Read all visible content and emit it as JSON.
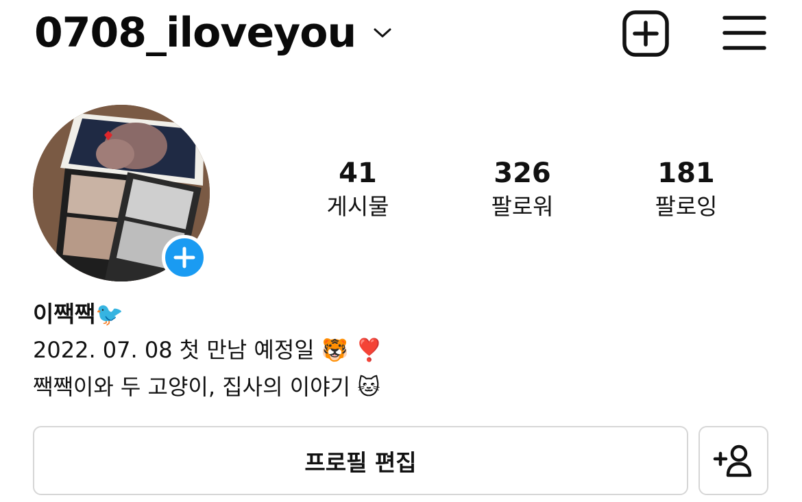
{
  "header": {
    "username": "0708_iloveyou",
    "create_icon": "plus-square-icon",
    "menu_icon": "hamburger-menu-icon"
  },
  "profile": {
    "avatar_icon": "profile-photo",
    "add_story_icon": "plus-icon",
    "stats": [
      {
        "value": "41",
        "label": "게시물"
      },
      {
        "value": "326",
        "label": "팔로워"
      },
      {
        "value": "181",
        "label": "팔로잉"
      }
    ],
    "display_name": "이짹짹",
    "display_name_emoji": "🐦",
    "bio_line1": "2022. 07. 08 첫 만남 예정일",
    "bio_line1_emoji": "🐯 ❣️",
    "bio_line2": "짹짹이와 두 고양이, 집사의 이야기",
    "bio_line2_emoji": "🐱"
  },
  "actions": {
    "edit_profile_label": "프로필 편집",
    "discover_people_icon": "add-person-icon"
  },
  "colors": {
    "accent_blue": "#1a9bf2",
    "button_border": "#d6d6d6",
    "text": "#111111"
  }
}
